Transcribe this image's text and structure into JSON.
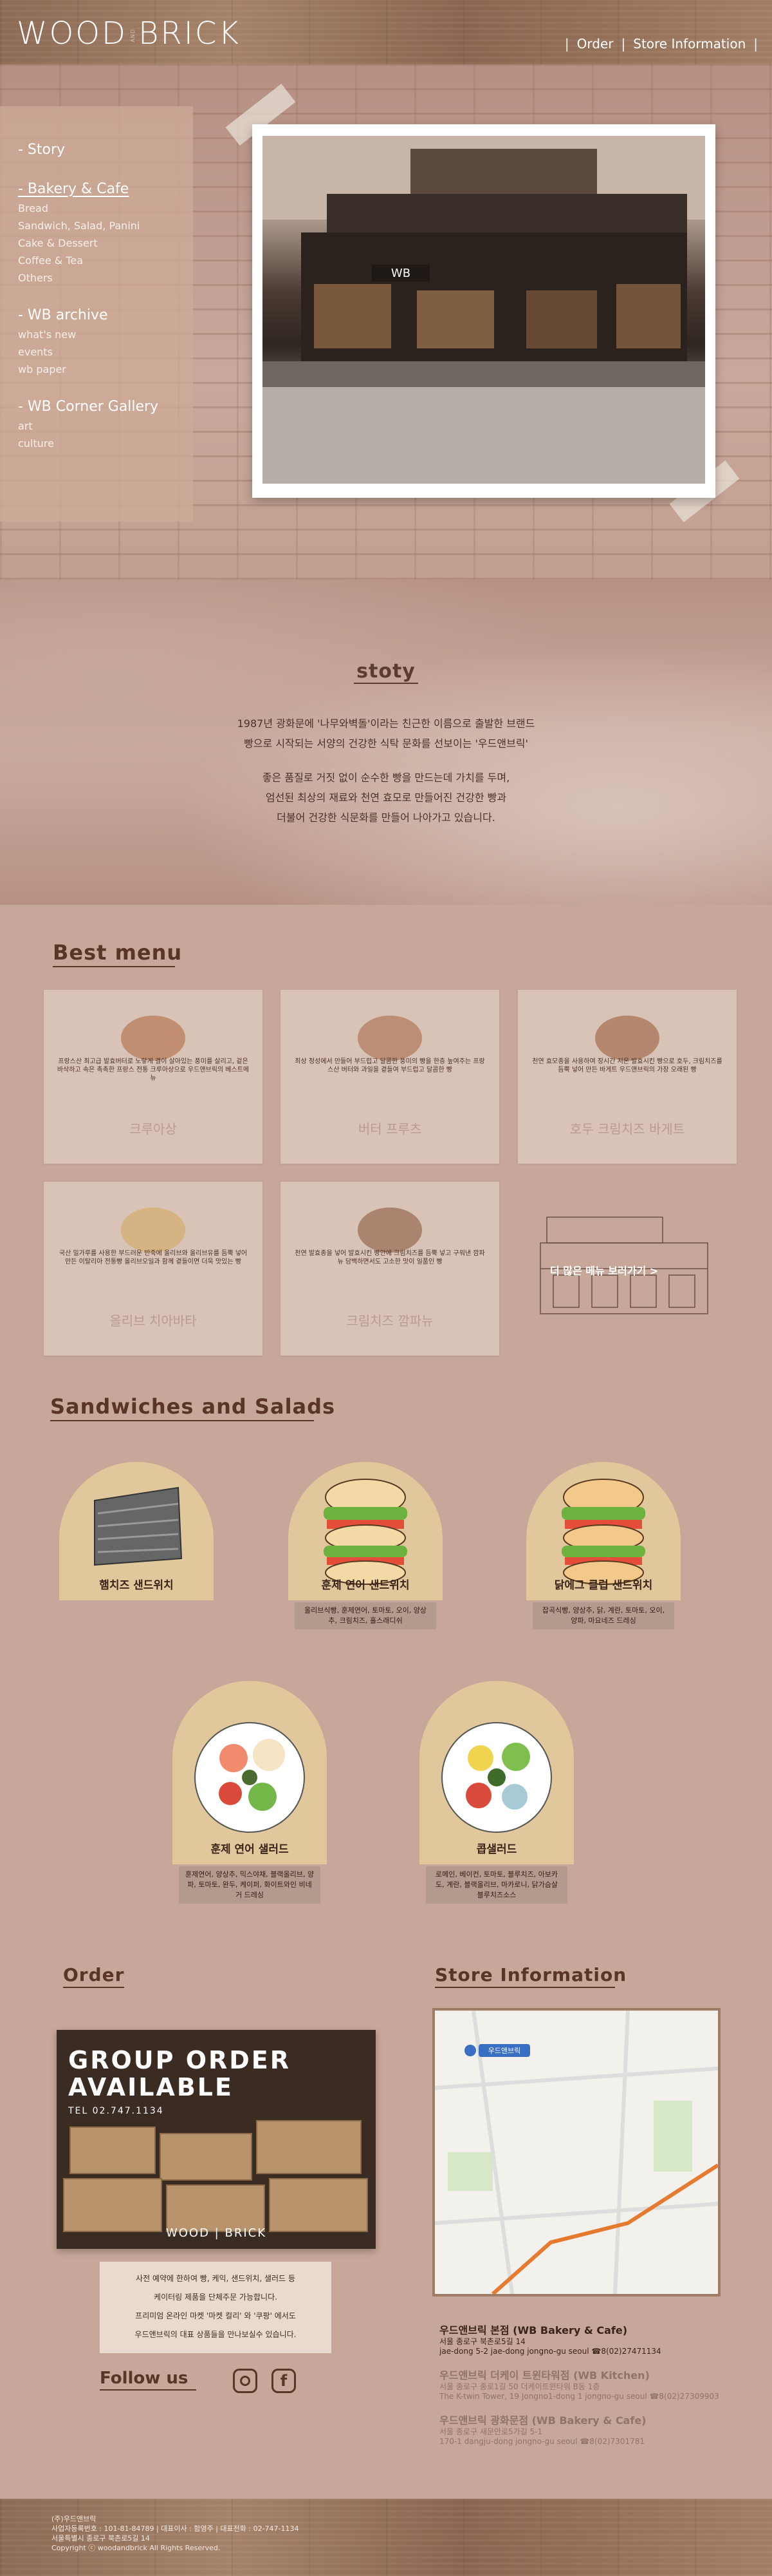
{
  "header": {
    "logo_left": "WOOD",
    "logo_and": "AND",
    "logo_right": "BRICK",
    "nav": [
      "|",
      "Order",
      "|",
      "Store Information",
      "|"
    ]
  },
  "side_menu": [
    {
      "title": "- Story",
      "items": []
    },
    {
      "title": "- Bakery & Cafe",
      "active": true,
      "items": [
        "Bread",
        "Sandwich, Salad, Panini",
        "Cake & Dessert",
        "Coffee & Tea",
        "Others"
      ]
    },
    {
      "title": "- WB archive",
      "items": [
        "what's new",
        "events",
        "wb paper"
      ]
    },
    {
      "title": "- WB Corner Gallery",
      "items": [
        "art",
        "culture"
      ]
    }
  ],
  "hero": {
    "sign": "WB"
  },
  "story": {
    "title": "stoty",
    "lines": [
      "1987년 광화문에 '나무와벽돌'이라는 친근한 이름으로 출발한 브랜드",
      "빵으로 시작되는 서양의 건강한 식탁 문화를 선보이는 '우드앤브릭'",
      "",
      "좋은 품질로 거짓 없이 순수한 빵을 만드는데 가치를 두며,",
      "엄선된 최상의 재료와 천연 효모로 만들어진 건강한 빵과",
      "더불어 건강한 식문화를 만들어 나아가고 있습니다."
    ]
  },
  "best_menu": {
    "title": "Best menu",
    "items": [
      {
        "name": "크루아상",
        "desc": "프랑스산 최고급 발효버터로 노랗게 결이 살아있는 풍미를 살리고, 겉은 바삭하고 속은 촉촉한 프랑스 전통 크루아상으로 우드앤브릭의 베스트메뉴",
        "color": "#b06a45"
      },
      {
        "name": "버터 프루츠",
        "desc": "최상 정성에서 만들어 부드럽고 달콤한 풍미의 빵을 한층 높여주는 프랑스산 버터와 과일을 곁들여 부드럽고 달콤한 빵",
        "color": "#a86a4a"
      },
      {
        "name": "호두 크림치즈 바게트",
        "desc": "천연 효모종을 사용하여 장시간 저온 발효시킨 빵으로 호두, 크림치즈를 듬뿍 넣어 만든 바게트 우드앤브릭의 가장 오래된 빵",
        "color": "#9a6040"
      },
      {
        "name": "올리브 치아바타",
        "desc": "국산 밀가루를 사용한 부드러운 반죽에 올리브와 올리브유를 듬뿍 넣어 만든 이탈리아 전통빵 올리브오일과 함께 곁들이면 더욱 맛있는 빵",
        "color": "#d4a860"
      },
      {
        "name": "크림치즈 깜파뉴",
        "desc": "천연 발효종을 넣어 발효시킨 빵안에 크림치즈를 듬뿍 넣고 구워낸 깜파뉴 담백하면서도 고소한 맛이 일품인 빵",
        "color": "#8a5a40"
      }
    ],
    "more": "더 많은 메뉴 보러가기 >"
  },
  "sandwiches": {
    "title": "Sandwiches and Salads",
    "items": [
      {
        "name": "햄치즈 샌드위치",
        "desc": ""
      },
      {
        "name": "훈제 연어 샌드위치",
        "desc": "올리브식빵, 훈제연어, 토마토, 오이, 양상추, 크림치즈, 홀스래디쉬"
      },
      {
        "name": "닭에그 클럽 샌드위치",
        "desc": "잡곡식빵, 양상추, 닭, 계란, 토마토, 오이, 양파, 마요네즈 드레싱"
      },
      {
        "name": "훈제 연어 샐러드",
        "desc": "훈제연어, 양상추, 믹스야채, 블랙올리브, 양파, 토마토, 완두, 케이퍼, 화이트와인 비네거 드레싱"
      },
      {
        "name": "콥샐러드",
        "desc": "로메인, 베이컨, 토마토, 블루치즈, 아보카도, 계란, 블랙올리브, 마카로니, 닭가슴살 블루치즈소스"
      }
    ]
  },
  "order": {
    "title": "Order",
    "banner_title_1": "GROUP ORDER",
    "banner_title_2": "AVAILABLE",
    "banner_tel": "TEL 02.747.1134",
    "banner_brand": "WOOD | BRICK",
    "text": [
      "사전 예약에 한하여 빵, 케익, 샌드위치, 샐러드 등",
      "케이터링 제품을 단체주문 가능합니다.",
      "프리미엄 온라인 마켓 '마켓 컬리' 와 '쿠팡' 에서도",
      "우드앤브릭의 대표 상품들을 만나보실수 있습니다."
    ]
  },
  "follow": {
    "title": "Follow us",
    "instagram": "instagram-icon",
    "facebook": "facebook-icon"
  },
  "store": {
    "title": "Store Information",
    "map_label": "우드앤브릭",
    "stores": [
      {
        "name": "우드앤브릭 본점 (WB Bakery & Cafe)",
        "addr1": "서울 종로구 북촌로5길 14",
        "addr2": "jae-dong 5-2 jae-dong jongno-gu seoul ☎8(02)27471134",
        "dim": false
      },
      {
        "name": "우드앤브릭 더케이 트윈타워점 (WB Kitchen)",
        "addr1": "서울 종로구 종로1길 50 더케이트윈타워 B동 1층",
        "addr2": "The K-twin Tower, 19 Jongno1-dong 1 jongno-gu seoul ☎8(02)27309903",
        "dim": true
      },
      {
        "name": "우드앤브릭 광화문점 (WB Bakery & Cafe)",
        "addr1": "서울 종로구 새문안로5가길 5-1",
        "addr2": "170-1 dangju-dong jongno-gu seoul ☎8(02)7301781",
        "dim": true
      }
    ]
  },
  "footer": {
    "lines": [
      "(주)우드앤브릭",
      "사업자등록번호 : 101-81-84789 | 대표이사 : 함영주 | 대표전화 : 02-747-1134",
      "서울특별시 종로구 북촌로5길 14",
      "Copyright ⓒ woodandbrick All Rights Reserved."
    ]
  },
  "colors": {
    "accent": "#5a3424",
    "background": "#c7a799",
    "wood": "#97735c"
  }
}
